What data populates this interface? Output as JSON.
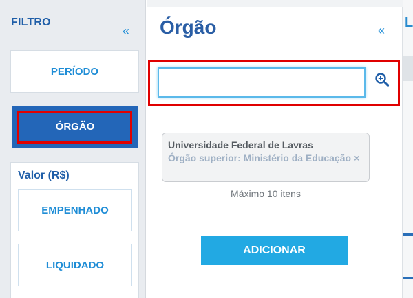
{
  "filter_panel": {
    "title": "FILTRO",
    "collapse_glyph": "«",
    "items": {
      "periodo": "PERÍODO",
      "orgao": "ÓRGÃO"
    },
    "valor_section": {
      "title": "Valor (R$)",
      "empenhado": "EMPENHADO",
      "liquidado": "LIQUIDADO"
    }
  },
  "orgao_panel": {
    "title": "Órgão",
    "collapse_glyph": "«",
    "search": {
      "value": "",
      "placeholder": "",
      "icon": "zoom-in-icon"
    },
    "selected_items": [
      {
        "name": "Universidade Federal de Lavras",
        "superior": "Órgão superior: Ministério da Educação",
        "remove_glyph": "×"
      }
    ],
    "max_note": "Máximo 10 itens",
    "add_label": "ADICIONAR"
  },
  "right_panel": {
    "edge_text": "L"
  },
  "colors": {
    "primary_blue": "#2366b8",
    "accent_blue": "#22a9e3",
    "highlight_red": "#e00000",
    "panel_bg": "#e9ecf0"
  }
}
